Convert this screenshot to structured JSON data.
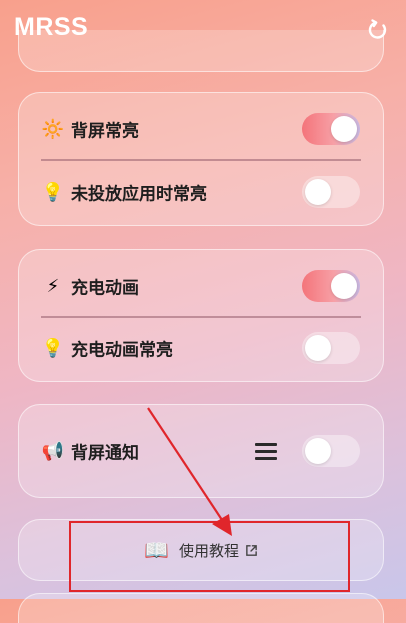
{
  "app": {
    "title": "MRSS"
  },
  "header": {
    "refresh_icon": "refresh-icon"
  },
  "card1": {
    "rows": [
      {
        "icon": "sun-icon",
        "glyph": "🔆",
        "label": "背屏常亮",
        "toggle_on": true
      },
      {
        "icon": "lightbulb-icon",
        "glyph": "💡",
        "label": "未投放应用时常亮",
        "toggle_on": false
      }
    ]
  },
  "card2": {
    "rows": [
      {
        "icon": "lightning-icon",
        "glyph": "⚡",
        "label": "充电动画",
        "toggle_on": true
      },
      {
        "icon": "lightbulb-icon",
        "glyph": "💡",
        "label": "充电动画常亮",
        "toggle_on": false
      }
    ]
  },
  "card3": {
    "row": {
      "icon": "megaphone-icon",
      "glyph": "📢",
      "label": "背屏通知",
      "toggle_on": false,
      "menu_icon": "menu-icon"
    }
  },
  "tutorial": {
    "icon": "book-icon",
    "glyph": "📖",
    "label": "使用教程",
    "link_icon": "external-link-icon"
  },
  "colors": {
    "toggle_on_start": "#f4747a",
    "annotation_red": "#e0262b",
    "title": "#ffffff"
  }
}
